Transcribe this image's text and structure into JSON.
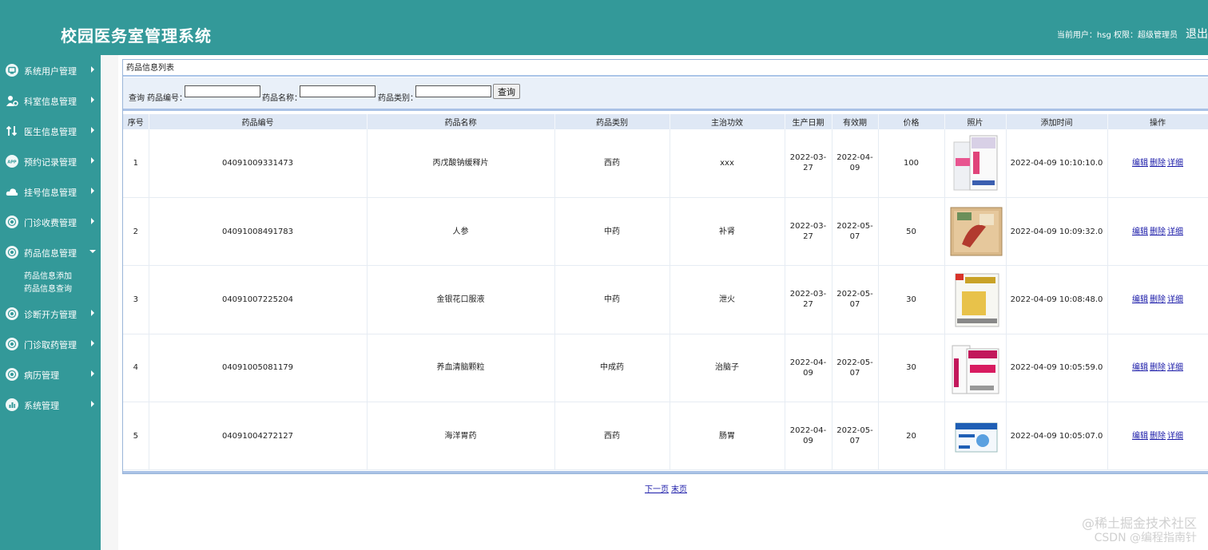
{
  "header": {
    "title": "校园医务室管理系统",
    "user_info": "当前用户：hsg 权限：超级管理员",
    "logout_label": "退出"
  },
  "sidebar": {
    "items": [
      {
        "label": "系统用户管理",
        "icon": "monitor-icon"
      },
      {
        "label": "科室信息管理",
        "icon": "user-settings-icon"
      },
      {
        "label": "医生信息管理",
        "icon": "transfer-icon"
      },
      {
        "label": "预约记录管理",
        "icon": "app-icon"
      },
      {
        "label": "挂号信息管理",
        "icon": "cloud-icon"
      },
      {
        "label": "门诊收费管理",
        "icon": "target-icon"
      },
      {
        "label": "药品信息管理",
        "icon": "target-icon",
        "expanded": true
      },
      {
        "label": "诊断开方管理",
        "icon": "target-icon"
      },
      {
        "label": "门诊取药管理",
        "icon": "target-icon"
      },
      {
        "label": "病历管理",
        "icon": "target-icon"
      },
      {
        "label": "系统管理",
        "icon": "bar-chart-icon"
      }
    ],
    "subitems": [
      "药品信息添加",
      "药品信息查询"
    ]
  },
  "panel": {
    "title": "药品信息列表",
    "search": {
      "query_label": "查询",
      "code_label": "药品编号：",
      "name_label": "药品名称：",
      "category_label": "药品类别：",
      "code_value": "",
      "name_value": "",
      "category_value": "",
      "button_label": "查询"
    }
  },
  "table": {
    "headers": [
      "序号",
      "药品编号",
      "药品名称",
      "药品类别",
      "主治功效",
      "生产日期",
      "有效期",
      "价格",
      "照片",
      "添加时间",
      "操作"
    ],
    "rows": [
      {
        "no": "1",
        "code": "04091009331473",
        "name": "丙戊酸钠缓释片",
        "category": "西药",
        "effect": "xxx",
        "prod_date": "2022-03-27",
        "expiry": "2022-04-09",
        "price": "100",
        "photo": "white-pink-medicine-box",
        "added": "2022-04-09 10:10:10.0"
      },
      {
        "no": "2",
        "code": "04091008491783",
        "name": "人参",
        "category": "中药",
        "effect": "补肾",
        "prod_date": "2022-03-27",
        "expiry": "2022-05-07",
        "price": "50",
        "photo": "ginseng-gift-box",
        "added": "2022-04-09 10:09:32.0"
      },
      {
        "no": "3",
        "code": "04091007225204",
        "name": "金银花口服液",
        "category": "中药",
        "effect": "泄火",
        "prod_date": "2022-03-27",
        "expiry": "2022-05-07",
        "price": "30",
        "photo": "yellow-medicine-box",
        "added": "2022-04-09 10:08:48.0"
      },
      {
        "no": "4",
        "code": "04091005081179",
        "name": "养血清脑颗粒",
        "category": "中成药",
        "effect": "治脑子",
        "prod_date": "2022-04-09",
        "expiry": "2022-05-07",
        "price": "30",
        "photo": "magenta-medicine-boxes",
        "added": "2022-04-09 10:05:59.0"
      },
      {
        "no": "5",
        "code": "04091004272127",
        "name": "海洋胃药",
        "category": "西药",
        "effect": "肠胃",
        "prod_date": "2022-04-09",
        "expiry": "2022-05-07",
        "price": "20",
        "photo": "blue-stomach-medicine-box",
        "added": "2022-04-09 10:05:07.0"
      }
    ],
    "ops": {
      "edit": "编辑",
      "delete": "删除",
      "detail": "详细"
    }
  },
  "pager": {
    "next": "下一页",
    "last": "末页"
  },
  "watermark": {
    "line1": "@稀土掘金技术社区",
    "line2": "CSDN @编程指南针"
  },
  "colors": {
    "primary": "#339999",
    "header_row": "#dfe8f5",
    "search_bg": "#e9f0f9",
    "link": "#1a1aa8"
  }
}
